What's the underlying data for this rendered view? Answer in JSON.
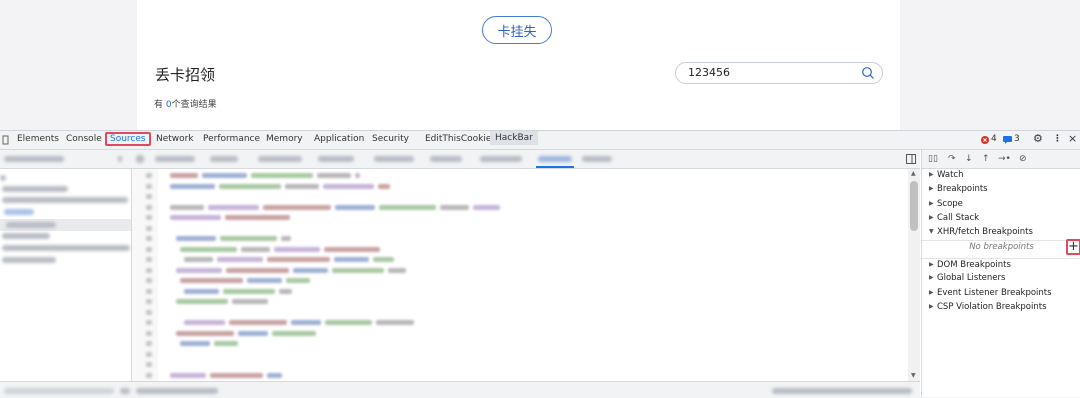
{
  "page": {
    "report_lost_button": "卡挂失",
    "lost_card_title": "丢卡招领",
    "search": {
      "value": "123456"
    },
    "result_prefix": "有 ",
    "result_count": "0",
    "result_suffix": "个查询结果"
  },
  "devtools": {
    "tabs": [
      "Elements",
      "Console",
      "Sources",
      "Network",
      "Performance",
      "Memory",
      "Application",
      "Security",
      "EditThisCookie",
      "HackBar"
    ],
    "active_tab": "Sources",
    "errors_count": "4",
    "messages_count": "3",
    "sidebar": {
      "panes": [
        "Watch",
        "Breakpoints",
        "Scope",
        "Call Stack",
        "XHR/fetch Breakpoints",
        "DOM Breakpoints",
        "Global Listeners",
        "Event Listener Breakpoints",
        "CSP Violation Breakpoints"
      ],
      "xhr_empty": "No breakpoints",
      "add_symbol": "+"
    }
  },
  "colors": {
    "accent": "#2d63c8",
    "highlight": "#e04a5c",
    "error": "#d93025",
    "info": "#1a73e8"
  }
}
